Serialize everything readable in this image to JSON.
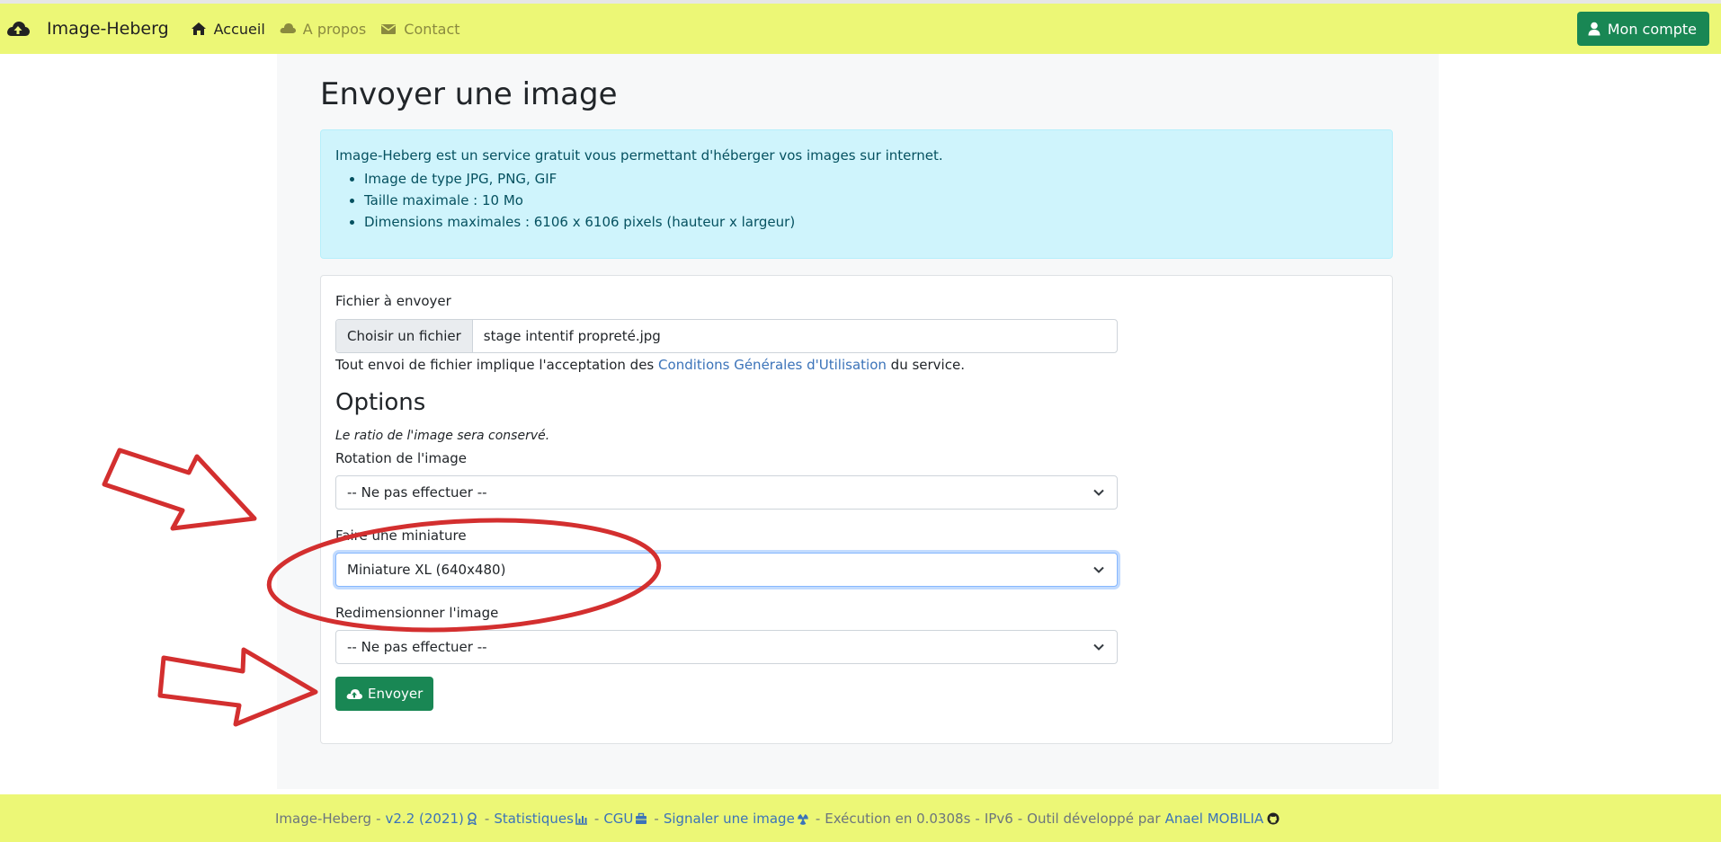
{
  "nav": {
    "brand": "Image-Heberg",
    "links": [
      {
        "label": "Accueil",
        "icon": "home-icon"
      },
      {
        "label": "A propos",
        "icon": "cloud-icon"
      },
      {
        "label": "Contact",
        "icon": "envelope-icon"
      }
    ],
    "account": "Mon compte"
  },
  "page": {
    "title": "Envoyer une image"
  },
  "alert": {
    "intro": "Image-Heberg est un service gratuit vous permettant d'héberger vos images sur internet.",
    "items": [
      "Image de type JPG, PNG, GIF",
      "Taille maximale : 10 Mo",
      "Dimensions maximales : 6106 x 6106 pixels (hauteur x largeur)"
    ]
  },
  "form": {
    "file_label": "Fichier à envoyer",
    "file_button": "Choisir un fichier",
    "file_name": "stage intentif propreté.jpg",
    "terms_before": "Tout envoi de fichier implique l'acceptation des",
    "terms_link": "Conditions Générales d'Utilisation",
    "terms_after": "du service.",
    "options_title": "Options",
    "ratio_note": "Le ratio de l'image sera conservé.",
    "rotation_label": "Rotation de l'image",
    "rotation_value": "-- Ne pas effectuer --",
    "thumbnail_label": "Faire une miniature",
    "thumbnail_value": "Miniature XL (640x480)",
    "resize_label": "Redimensionner l'image",
    "resize_value": "-- Ne pas effectuer --",
    "submit": "Envoyer"
  },
  "footer": {
    "app": "Image-Heberg",
    "version": "v2.2 (2021)",
    "stats": "Statistiques",
    "cgu": "CGU",
    "report": "Signaler une image",
    "exec": "Exécution en 0.0308s",
    "ip": "IPv6",
    "tool": "Outil développé par",
    "author": "Anael MOBILIA"
  },
  "colors": {
    "navbar": "#ecf776",
    "primary_green": "#198754",
    "alert_bg": "#cff4fc",
    "link": "#3b73b9",
    "annotation_red": "#d32f2f"
  }
}
